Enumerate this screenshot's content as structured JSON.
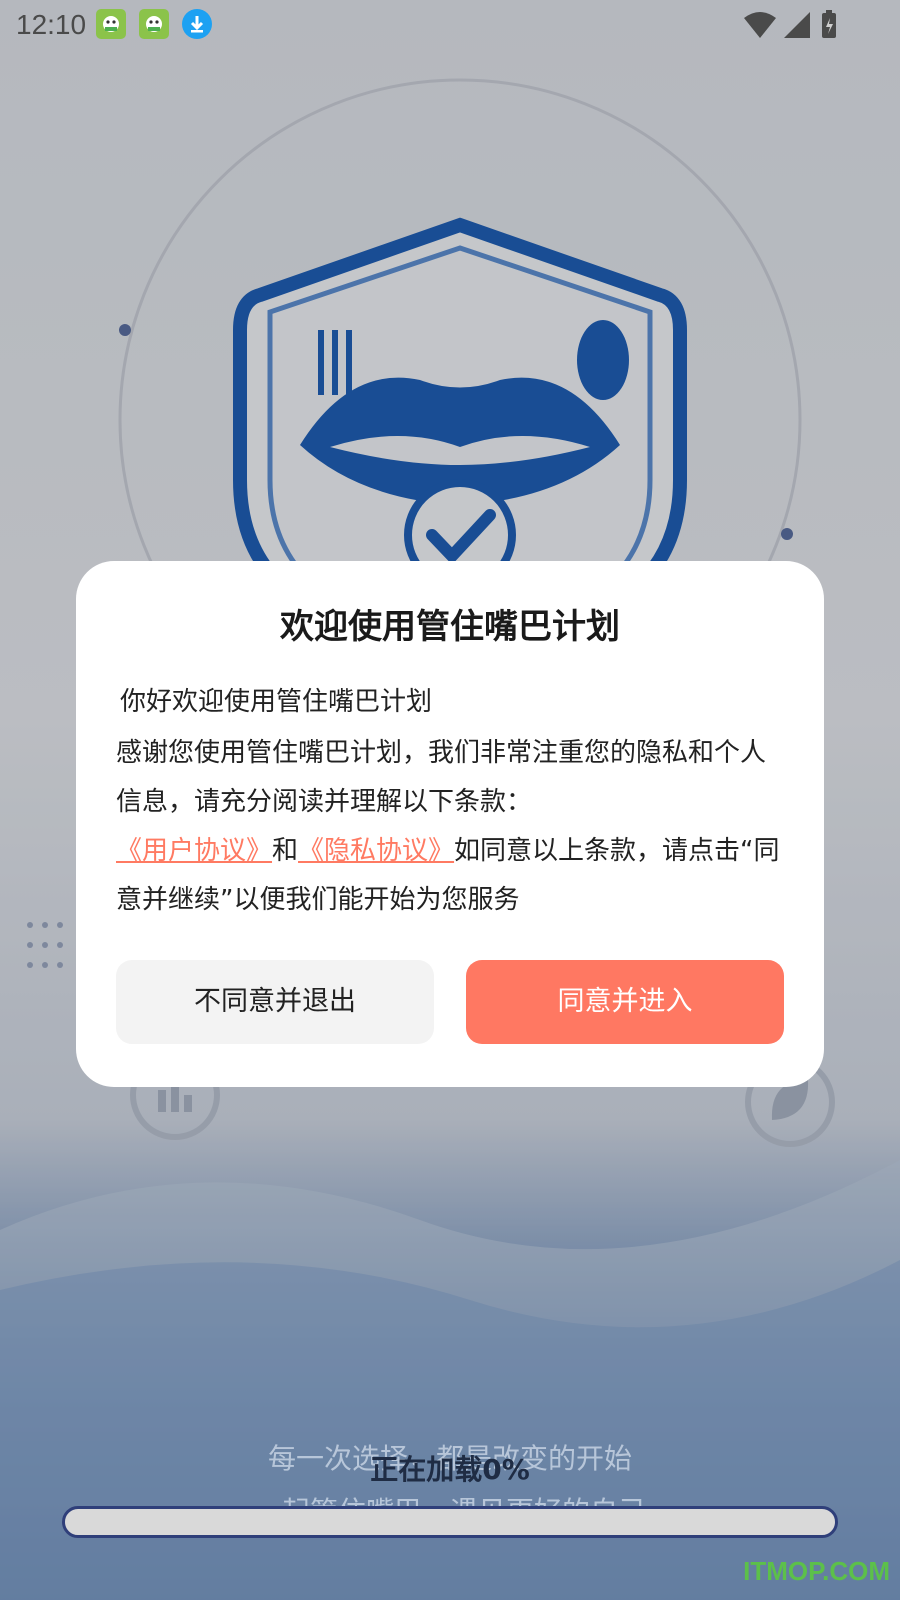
{
  "status_bar": {
    "time": "12:10",
    "notification_icons": [
      "app-icon",
      "app-icon",
      "download-icon"
    ],
    "system_icons": [
      "wifi-icon",
      "signal-icon",
      "battery-icon"
    ]
  },
  "dialog": {
    "title": "欢迎使用管住嘴巴计划",
    "greeting": "你好欢迎使用管住嘴巴计划",
    "body_part1": "感谢您使用管住嘴巴计划，我们非常注重您的隐私和个人信息，请充分阅读并理解以下条款：",
    "user_agreement_link": "《用户协议》",
    "and_text": "和",
    "privacy_link": "《隐私协议》",
    "body_part2": "如同意以上条款，请点击“同意并继续”以便我们能开始为您服务",
    "disagree_button": "不同意并退出",
    "agree_button": "同意并进入"
  },
  "splash": {
    "slogan_line1": "每一次选择，都是改变的开始",
    "slogan_line2": "一起管住嘴巴，遇见更好的自己",
    "loading_text": "正在加载0%",
    "progress_percent": 0
  },
  "watermark": "ITMOP.COM",
  "colors": {
    "accent": "#ff7862",
    "link": "#ff7a62",
    "brand_blue": "#1d4f95"
  }
}
